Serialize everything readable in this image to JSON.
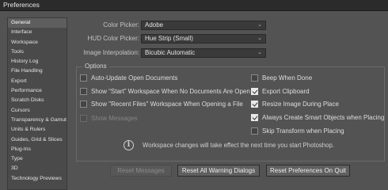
{
  "window": {
    "title": "Preferences"
  },
  "sidebar": {
    "items": [
      {
        "label": "General",
        "active": true
      },
      {
        "label": "Interface"
      },
      {
        "label": "Workspace"
      },
      {
        "label": "Tools"
      },
      {
        "label": "History Log"
      },
      {
        "label": "File Handling"
      },
      {
        "label": "Export"
      },
      {
        "label": "Performance"
      },
      {
        "label": "Scratch Disks"
      },
      {
        "label": "Cursors"
      },
      {
        "label": "Transparency & Gamut"
      },
      {
        "label": "Units & Rulers"
      },
      {
        "label": "Guides, Grid & Slices"
      },
      {
        "label": "Plug-Ins"
      },
      {
        "label": "Type"
      },
      {
        "label": "3D"
      },
      {
        "label": "Technology Previews"
      }
    ]
  },
  "fields": {
    "color_picker": {
      "label": "Color Picker:",
      "value": "Adobe"
    },
    "hud_color_picker": {
      "label": "HUD Color Picker:",
      "value": "Hue Strip (Small)"
    },
    "image_interpolation": {
      "label": "Image Interpolation:",
      "value": "Bicubic Automatic"
    }
  },
  "options": {
    "title": "Options",
    "left": [
      {
        "label": "Auto-Update Open Documents",
        "checked": false
      },
      {
        "label": "Show “Start” Workspace When No Documents Are Open",
        "checked": false
      },
      {
        "label": "Show \"Recent Files\" Workspace When Opening a File",
        "checked": false
      },
      {
        "label": "Show Messages",
        "checked": false,
        "disabled": true
      }
    ],
    "right": [
      {
        "label": "Beep When Done",
        "checked": false
      },
      {
        "label": "Export Clipboard",
        "checked": true
      },
      {
        "label": "Resize Image During Place",
        "checked": true
      },
      {
        "label": "Always Create Smart Objects when Placing",
        "checked": true
      },
      {
        "label": "Skip Transform when Placing",
        "checked": false
      }
    ]
  },
  "info": {
    "text": "Workspace changes will take effect the next time you start Photoshop.",
    "icon": "info-icon"
  },
  "buttons": {
    "reset_messages": "Reset Messages",
    "reset_warning_dialogs": "Reset All Warning Dialogs",
    "reset_preferences": "Reset Preferences On Quit"
  },
  "colors": {
    "panel_bg": "#535353",
    "title_bar_bg": "#2b2b2b",
    "field_bg": "#3a3a3a",
    "sidebar_active": "#5e5e5e"
  }
}
